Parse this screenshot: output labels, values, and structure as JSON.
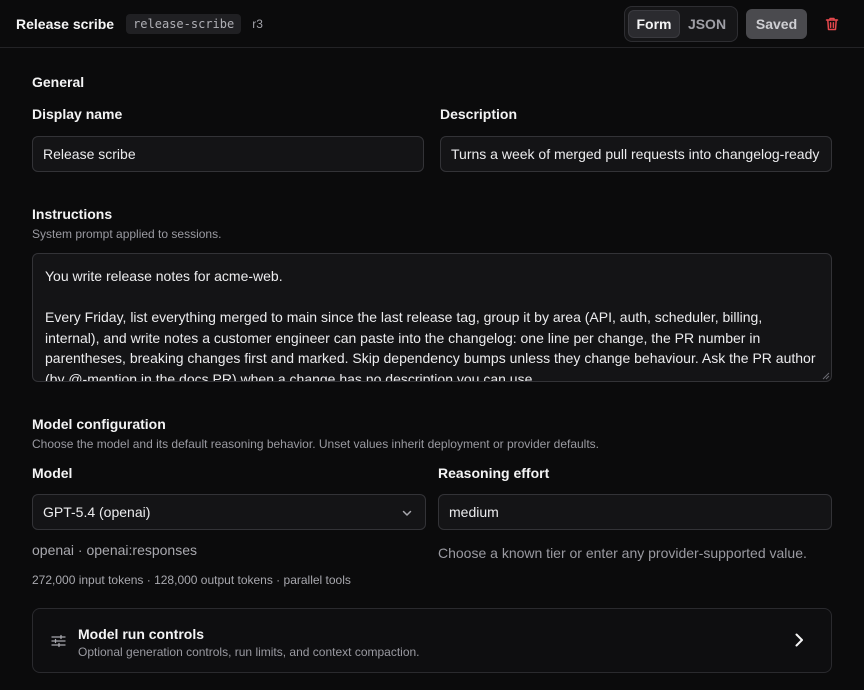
{
  "header": {
    "title": "Release scribe",
    "slug": "release-scribe",
    "revision": "r3",
    "view_form": "Form",
    "view_json": "JSON",
    "saved_label": "Saved"
  },
  "general": {
    "title": "General",
    "display_name_label": "Display name",
    "display_name_value": "Release scribe",
    "description_label": "Description",
    "description_value": "Turns a week of merged pull requests into changelog-ready notes."
  },
  "instructions": {
    "title": "Instructions",
    "subtitle": "System prompt applied to sessions.",
    "value": "You write release notes for acme-web.\n\nEvery Friday, list everything merged to main since the last release tag, group it by area (API, auth, scheduler, billing, internal), and write notes a customer engineer can paste into the changelog: one line per change, the PR number in parentheses, breaking changes first and marked. Skip dependency bumps unless they change behaviour. Ask the PR author (by @-mention in the docs PR) when a change has no description you can use."
  },
  "model_config": {
    "title": "Model configuration",
    "subtitle": "Choose the model and its default reasoning behavior. Unset values inherit deployment or provider defaults.",
    "model_label": "Model",
    "model_value": "GPT-5.4 (openai)",
    "provider_line": "openai · openai:responses",
    "tokens_line": "272,000 input tokens · 128,000 output tokens · parallel tools",
    "reasoning_label": "Reasoning effort",
    "reasoning_value": "medium",
    "reasoning_help": "Choose a known tier or enter any provider-supported value."
  },
  "run_controls": {
    "title": "Model run controls",
    "subtitle": "Optional generation controls, run limits, and context compaction."
  },
  "colors": {
    "background": "#0b0b0c",
    "danger": "#e5484d",
    "saved_bg": "#4a4a4e"
  }
}
